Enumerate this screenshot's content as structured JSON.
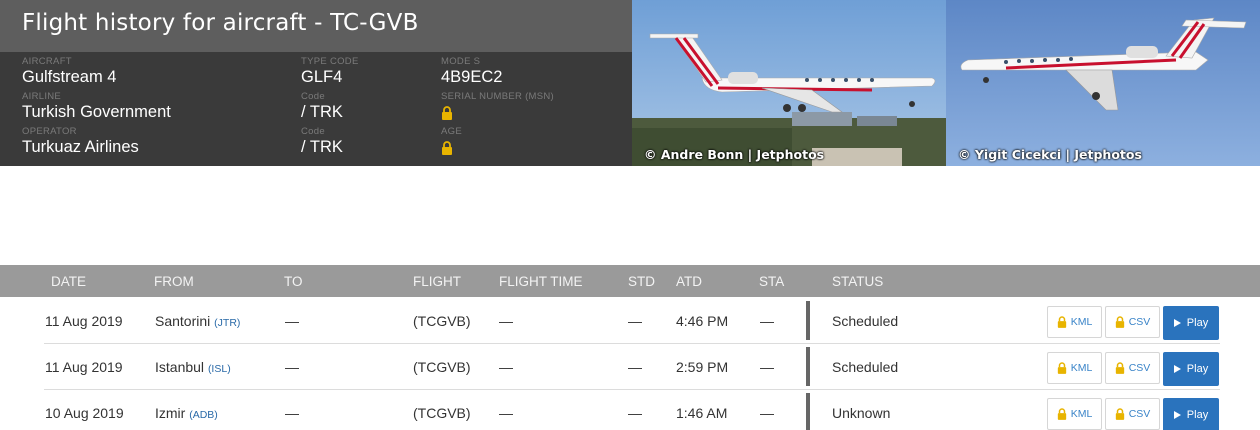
{
  "header": {
    "title": "Flight history for aircraft - TC-GVB",
    "aircraft": {
      "label": "AIRCRAFT",
      "value": "Gulfstream 4"
    },
    "airline": {
      "label": "AIRLINE",
      "value": "Turkish Government"
    },
    "operator": {
      "label": "OPERATOR",
      "value": "Turkuaz Airlines"
    },
    "type_code": {
      "label": "TYPE CODE",
      "value": "GLF4"
    },
    "airline_code": {
      "label": "Code",
      "value": "/ TRK"
    },
    "operator_code": {
      "label": "Code",
      "value": "/ TRK"
    },
    "mode_s": {
      "label": "MODE S",
      "value": "4B9EC2"
    },
    "serial_number": {
      "label": "SERIAL NUMBER (MSN)",
      "icon": "lock-icon"
    },
    "age": {
      "label": "AGE",
      "icon": "lock-icon"
    }
  },
  "photos": [
    {
      "credit": "© Andre Bonn | Jetphotos"
    },
    {
      "credit": "© Yigit Cicekci | Jetphotos"
    }
  ],
  "table": {
    "headers": [
      "DATE",
      "FROM",
      "TO",
      "FLIGHT",
      "FLIGHT TIME",
      "STD",
      "ATD",
      "STA",
      "STATUS"
    ],
    "rows": [
      {
        "date": "11 Aug 2019",
        "from": "Santorini",
        "from_code": "(JTR)",
        "to": "—",
        "flight": "(TCGVB)",
        "flight_time": "—",
        "std": "—",
        "atd": "4:46 PM",
        "sta": "—",
        "status": "Scheduled"
      },
      {
        "date": "11 Aug 2019",
        "from": "Istanbul",
        "from_code": "(ISL)",
        "to": "—",
        "flight": "(TCGVB)",
        "flight_time": "—",
        "std": "—",
        "atd": "2:59 PM",
        "sta": "—",
        "status": "Scheduled"
      },
      {
        "date": "10 Aug 2019",
        "from": "Izmir",
        "from_code": "(ADB)",
        "to": "—",
        "flight": "(TCGVB)",
        "flight_time": "—",
        "std": "—",
        "atd": "1:46 AM",
        "sta": "—",
        "status": "Unknown"
      }
    ],
    "buttons": {
      "kml": "KML",
      "csv": "CSV",
      "play": "Play"
    }
  },
  "colors": {
    "lock": "#e8b400",
    "play_button": "#2a73bd",
    "link": "#3a84c8",
    "livery_red": "#c8102e"
  }
}
